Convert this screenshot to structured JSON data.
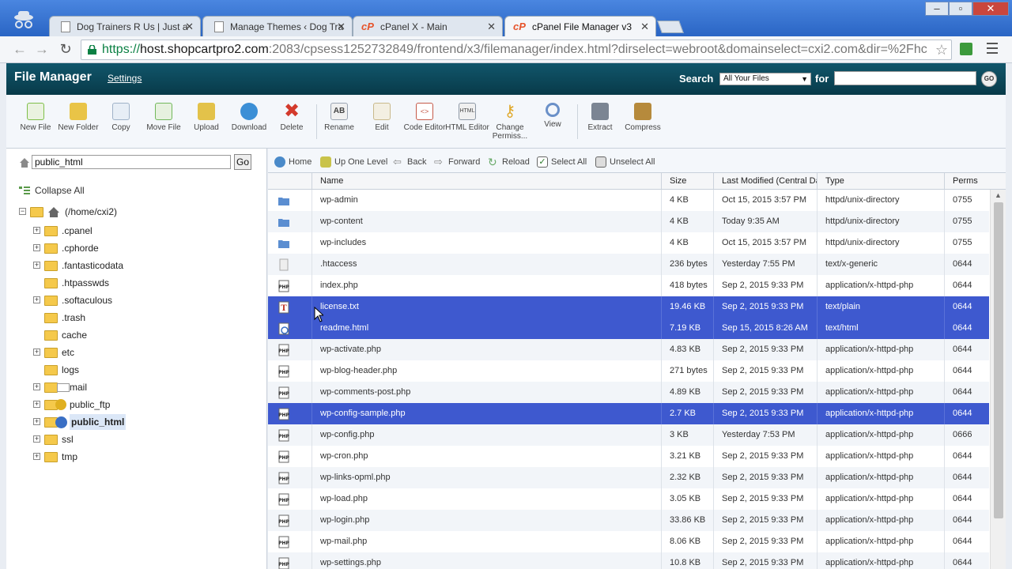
{
  "browser": {
    "tabs": [
      {
        "label": "Dog Trainers R Us | Just a",
        "type": "doc"
      },
      {
        "label": "Manage Themes ‹ Dog Tra",
        "type": "doc"
      },
      {
        "label": "cPanel X - Main",
        "type": "cpanel"
      },
      {
        "label": "cPanel File Manager v3",
        "type": "cpanel"
      }
    ],
    "url_scheme": "https://",
    "url_host": "host.shopcartpro2.com",
    "url_rest": ":2083/cpsess1252732849/frontend/x3/filemanager/index.html?dirselect=webroot&domainselect=cxi2.com&dir=%2Fhc"
  },
  "header": {
    "title": "File Manager",
    "settings": "Settings",
    "search_label": "Search",
    "search_scope": "All Your Files",
    "for_label": "for",
    "go": "GO"
  },
  "toolbar": [
    {
      "label": "New File",
      "icon": "new-file-icon",
      "color": "#7fbf4a"
    },
    {
      "label": "New Folder",
      "icon": "new-folder-icon",
      "color": "#e9c447"
    },
    {
      "label": "Copy",
      "icon": "copy-icon",
      "color": "#b8c8dc"
    },
    {
      "label": "Move File",
      "icon": "move-file-icon",
      "color": "#72b85c"
    },
    {
      "label": "Upload",
      "icon": "upload-icon",
      "color": "#e3c24a"
    },
    {
      "label": "Download",
      "icon": "download-icon",
      "color": "#3c8fd6"
    },
    {
      "label": "Delete",
      "icon": "delete-icon",
      "color": "#d33a2c"
    },
    {
      "label": "Rename",
      "icon": "rename-icon",
      "color": "#9aa4b2"
    },
    {
      "label": "Edit",
      "icon": "edit-icon",
      "color": "#c9b98c"
    },
    {
      "label": "Code Editor",
      "icon": "code-editor-icon",
      "color": "#c55a4a"
    },
    {
      "label": "HTML Editor",
      "icon": "html-editor-icon",
      "color": "#8d98a6"
    },
    {
      "label": "Change Permiss...",
      "icon": "key-icon",
      "color": "#e0a92c"
    },
    {
      "label": "View",
      "icon": "magnifier-icon",
      "color": "#6a90c8"
    },
    {
      "label": "Extract",
      "icon": "extract-icon",
      "color": "#7b8593"
    },
    {
      "label": "Compress",
      "icon": "compress-icon",
      "color": "#b68a3c"
    }
  ],
  "left": {
    "path": "public_html",
    "go": "Go",
    "collapse_all": "Collapse All",
    "root": "(/home/cxi2)",
    "tree": [
      {
        "label": ".cpanel",
        "expandable": true
      },
      {
        "label": ".cphorde",
        "expandable": true
      },
      {
        "label": ".fantasticodata",
        "expandable": true
      },
      {
        "label": ".htpasswds",
        "expandable": false
      },
      {
        "label": ".softaculous",
        "expandable": true
      },
      {
        "label": ".trash",
        "expandable": false
      },
      {
        "label": "cache",
        "expandable": false
      },
      {
        "label": "etc",
        "expandable": true
      },
      {
        "label": "logs",
        "expandable": false
      },
      {
        "label": "mail",
        "expandable": true
      },
      {
        "label": "public_ftp",
        "expandable": true
      },
      {
        "label": "public_html",
        "expandable": true
      },
      {
        "label": "ssl",
        "expandable": true
      },
      {
        "label": "tmp",
        "expandable": true
      }
    ]
  },
  "nav": {
    "home": "Home",
    "up": "Up One Level",
    "back": "Back",
    "forward": "Forward",
    "reload": "Reload",
    "select_all": "Select All",
    "unselect_all": "Unselect All"
  },
  "table": {
    "headers": {
      "name": "Name",
      "size": "Size",
      "modified": "Last Modified (Central Da",
      "type": "Type",
      "perms": "Perms"
    },
    "rows": [
      {
        "name": "wp-admin",
        "size": "4 KB",
        "modified": "Oct 15, 2015 3:57 PM",
        "type": "httpd/unix-directory",
        "perms": "0755",
        "kind": "folder",
        "selected": false
      },
      {
        "name": "wp-content",
        "size": "4 KB",
        "modified": "Today 9:35 AM",
        "type": "httpd/unix-directory",
        "perms": "0755",
        "kind": "folder",
        "selected": false
      },
      {
        "name": "wp-includes",
        "size": "4 KB",
        "modified": "Oct 15, 2015 3:57 PM",
        "type": "httpd/unix-directory",
        "perms": "0755",
        "kind": "folder",
        "selected": false
      },
      {
        "name": ".htaccess",
        "size": "236 bytes",
        "modified": "Yesterday 7:55 PM",
        "type": "text/x-generic",
        "perms": "0644",
        "kind": "generic",
        "selected": false
      },
      {
        "name": "index.php",
        "size": "418 bytes",
        "modified": "Sep 2, 2015 9:33 PM",
        "type": "application/x-httpd-php",
        "perms": "0644",
        "kind": "php",
        "selected": false
      },
      {
        "name": "license.txt",
        "size": "19.46 KB",
        "modified": "Sep 2, 2015 9:33 PM",
        "type": "text/plain",
        "perms": "0644",
        "kind": "text",
        "selected": true
      },
      {
        "name": "readme.html",
        "size": "7.19 KB",
        "modified": "Sep 15, 2015 8:26 AM",
        "type": "text/html",
        "perms": "0644",
        "kind": "html",
        "selected": true
      },
      {
        "name": "wp-activate.php",
        "size": "4.83 KB",
        "modified": "Sep 2, 2015 9:33 PM",
        "type": "application/x-httpd-php",
        "perms": "0644",
        "kind": "php",
        "selected": false
      },
      {
        "name": "wp-blog-header.php",
        "size": "271 bytes",
        "modified": "Sep 2, 2015 9:33 PM",
        "type": "application/x-httpd-php",
        "perms": "0644",
        "kind": "php",
        "selected": false
      },
      {
        "name": "wp-comments-post.php",
        "size": "4.89 KB",
        "modified": "Sep 2, 2015 9:33 PM",
        "type": "application/x-httpd-php",
        "perms": "0644",
        "kind": "php",
        "selected": false
      },
      {
        "name": "wp-config-sample.php",
        "size": "2.7 KB",
        "modified": "Sep 2, 2015 9:33 PM",
        "type": "application/x-httpd-php",
        "perms": "0644",
        "kind": "php",
        "selected": true
      },
      {
        "name": "wp-config.php",
        "size": "3 KB",
        "modified": "Yesterday 7:53 PM",
        "type": "application/x-httpd-php",
        "perms": "0666",
        "kind": "php",
        "selected": false
      },
      {
        "name": "wp-cron.php",
        "size": "3.21 KB",
        "modified": "Sep 2, 2015 9:33 PM",
        "type": "application/x-httpd-php",
        "perms": "0644",
        "kind": "php",
        "selected": false
      },
      {
        "name": "wp-links-opml.php",
        "size": "2.32 KB",
        "modified": "Sep 2, 2015 9:33 PM",
        "type": "application/x-httpd-php",
        "perms": "0644",
        "kind": "php",
        "selected": false
      },
      {
        "name": "wp-load.php",
        "size": "3.05 KB",
        "modified": "Sep 2, 2015 9:33 PM",
        "type": "application/x-httpd-php",
        "perms": "0644",
        "kind": "php",
        "selected": false
      },
      {
        "name": "wp-login.php",
        "size": "33.86 KB",
        "modified": "Sep 2, 2015 9:33 PM",
        "type": "application/x-httpd-php",
        "perms": "0644",
        "kind": "php",
        "selected": false
      },
      {
        "name": "wp-mail.php",
        "size": "8.06 KB",
        "modified": "Sep 2, 2015 9:33 PM",
        "type": "application/x-httpd-php",
        "perms": "0644",
        "kind": "php",
        "selected": false
      },
      {
        "name": "wp-settings.php",
        "size": "10.8 KB",
        "modified": "Sep 2, 2015 9:33 PM",
        "type": "application/x-httpd-php",
        "perms": "0644",
        "kind": "php",
        "selected": false
      }
    ]
  }
}
